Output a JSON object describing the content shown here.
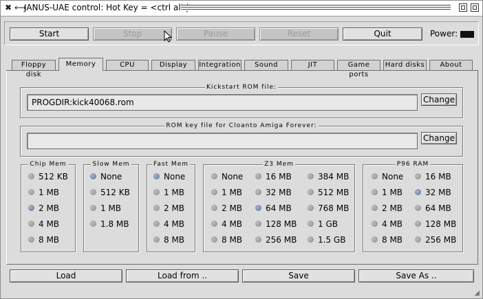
{
  "window": {
    "title": "JANUS-UAE control: Hot Key = <ctrl alt j>"
  },
  "controls": {
    "start": "Start",
    "stop": "Stop",
    "pause": "Pause",
    "reset": "Reset",
    "quit": "Quit",
    "power_label": "Power:"
  },
  "tabs": [
    "Floppy disk",
    "Memory",
    "CPU",
    "Display",
    "Integration",
    "Sound",
    "JIT",
    "Game ports",
    "Hard disks",
    "About"
  ],
  "active_tab": "Memory",
  "kickstart": {
    "title": "Kickstart ROM file:",
    "value": "PROGDIR:kick40068.rom",
    "change": "Change"
  },
  "romkey": {
    "title": "ROM key file for Cloanto Amiga Forever:",
    "value": "",
    "change": "Change"
  },
  "chip_mem": {
    "title": "Chip Mem",
    "options": [
      "512 KB",
      "1 MB",
      "2 MB",
      "4 MB",
      "8 MB"
    ],
    "selected": "2 MB"
  },
  "slow_mem": {
    "title": "Slow Mem",
    "options": [
      "None",
      "512 KB",
      "1 MB",
      "1.8 MB"
    ],
    "selected": "None"
  },
  "fast_mem": {
    "title": "Fast Mem",
    "options": [
      "None",
      "1 MB",
      "2 MB",
      "4 MB",
      "8 MB"
    ],
    "selected": "None"
  },
  "z3_mem": {
    "title": "Z3 Mem",
    "options": [
      "None",
      "1 MB",
      "2 MB",
      "4 MB",
      "8 MB",
      "16 MB",
      "32 MB",
      "64 MB",
      "128 MB",
      "256 MB",
      "384 MB",
      "512 MB",
      "768 MB",
      "1 GB",
      "1.5 GB"
    ],
    "selected": "64 MB"
  },
  "p96_ram": {
    "title": "P96 RAM",
    "options": [
      "None",
      "1 MB",
      "2 MB",
      "4 MB",
      "8 MB",
      "16 MB",
      "32 MB",
      "64 MB",
      "128 MB",
      "256 MB"
    ],
    "selected": "32 MB"
  },
  "bottom": {
    "load": "Load",
    "load_from": "Load from ..",
    "save": "Save",
    "save_as": "Save As .."
  },
  "colors": {
    "background": "#dcdcdc",
    "radio_selected": "#5a6f8f",
    "power_led": "#111111"
  }
}
